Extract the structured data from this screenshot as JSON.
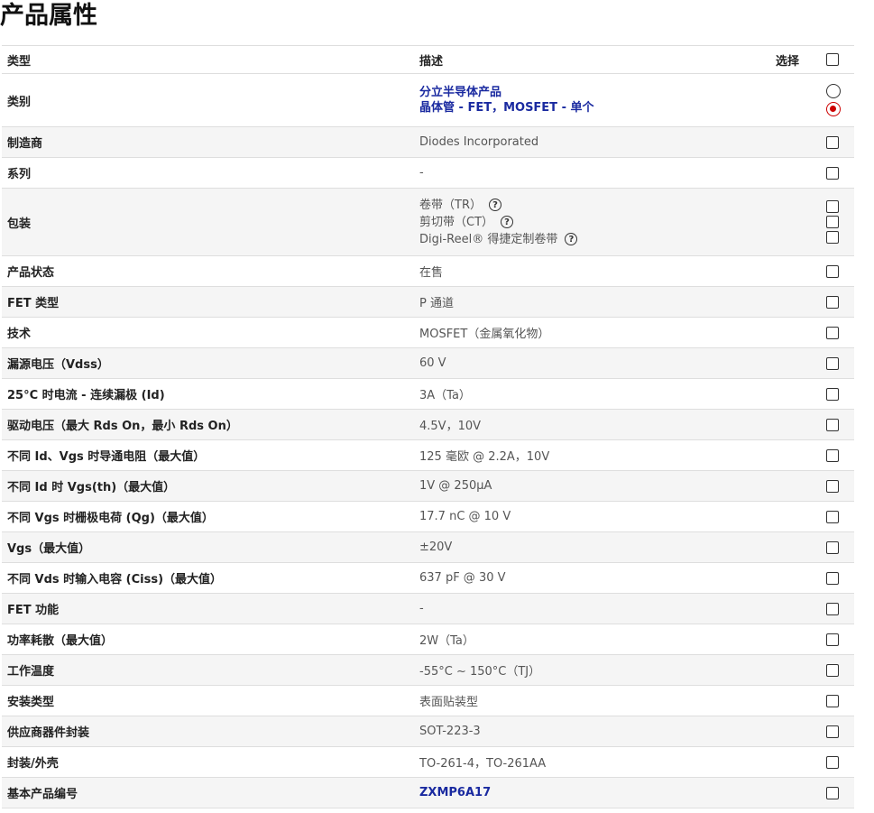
{
  "page_title": "产品属性",
  "header": {
    "type": "类型",
    "description": "描述",
    "select": "选择"
  },
  "category": {
    "label": "类别",
    "options": [
      "分立半导体产品",
      "晶体管 - FET，MOSFET - 单个"
    ]
  },
  "package": {
    "label": "包装",
    "options": [
      "卷带（TR）",
      "剪切带（CT）",
      "Digi-Reel® 得捷定制卷带"
    ]
  },
  "rows": [
    {
      "label": "制造商",
      "value": "Diodes Incorporated"
    },
    {
      "label": "系列",
      "value": "-"
    },
    {
      "label": "产品状态",
      "value": "在售"
    },
    {
      "label": "FET 类型",
      "value": "P 通道"
    },
    {
      "label": "技术",
      "value": "MOSFET（金属氧化物）"
    },
    {
      "label": "漏源电压（Vdss）",
      "value": "60 V"
    },
    {
      "label": "25°C 时电流 - 连续漏极 (Id)",
      "value": "3A（Ta）"
    },
    {
      "label": "驱动电压（最大 Rds On，最小 Rds On）",
      "value": "4.5V，10V"
    },
    {
      "label": "不同 Id、Vgs 时导通电阻（最大值）",
      "value": "125 毫欧 @ 2.2A，10V"
    },
    {
      "label": "不同 Id 时 Vgs(th)（最大值）",
      "value": "1V @ 250µA"
    },
    {
      "label": "不同 Vgs 时栅极电荷 (Qg)（最大值）",
      "value": "17.7 nC @ 10 V"
    },
    {
      "label": "Vgs（最大值）",
      "value": "±20V"
    },
    {
      "label": "不同 Vds 时输入电容 (Ciss)（最大值）",
      "value": "637 pF @ 30 V"
    },
    {
      "label": "FET 功能",
      "value": "-"
    },
    {
      "label": "功率耗散（最大值）",
      "value": "2W（Ta）"
    },
    {
      "label": "工作温度",
      "value": "-55°C ~ 150°C（TJ）"
    },
    {
      "label": "安装类型",
      "value": "表面贴装型"
    },
    {
      "label": "供应商器件封装",
      "value": "SOT-223-3"
    },
    {
      "label": "封装/外壳",
      "value": "TO-261-4，TO-261AA"
    },
    {
      "label": "基本产品编号",
      "value": "ZXMP6A17"
    }
  ]
}
